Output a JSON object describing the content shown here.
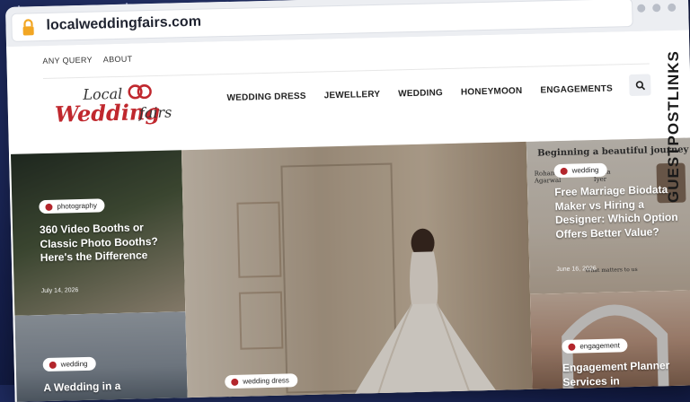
{
  "browser": {
    "url": "localweddingfairs.com"
  },
  "top_nav": [
    "ANY QUERY",
    "ABOUT"
  ],
  "logo": {
    "line1": "Local",
    "line2": "Wedding",
    "line3": "fairs"
  },
  "main_nav": [
    "WEDDING DRESS",
    "JEWELLERY",
    "WEDDING",
    "HONEYMOON",
    "ENGAGEMENTS"
  ],
  "side_brand": "GUESTPOSTLINKS",
  "posts": [
    {
      "tag": "photography",
      "title": "360 Video Booths or Classic Photo Booths? Here's the Difference",
      "date": "July 14, 2026"
    },
    {
      "tag": "wedding",
      "title": "A Wedding in a",
      "date": ""
    },
    {
      "tag": "wedding dress",
      "title": "",
      "date": ""
    },
    {
      "tag": "wedding",
      "title": "Free Marriage Biodata Maker vs Hiring a Designer: Which Option Offers Better Value?",
      "date": "June 16, 2026",
      "bg_text": {
        "headline": "Beginning a beautiful journey",
        "name1": "Rohan Agarwal",
        "name2": "Neha Iyer",
        "footer": "What matters to us"
      }
    },
    {
      "tag": "engagement",
      "title": "Engagement Planner Services in",
      "date": ""
    }
  ],
  "colors": {
    "accent": "#b3262c",
    "logo_red": "#c0282e"
  },
  "icons": {
    "lock": "lock-icon",
    "search": "search-icon"
  }
}
